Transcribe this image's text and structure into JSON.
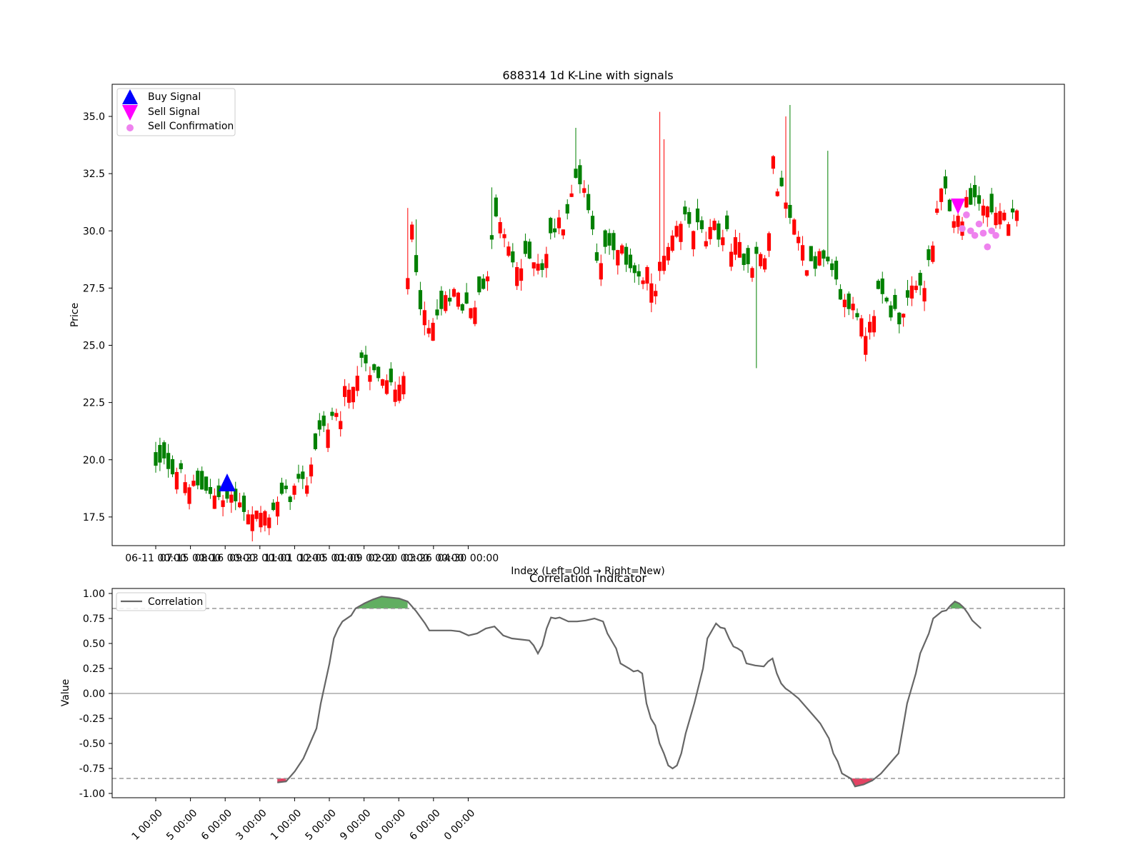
{
  "chart_data": [
    {
      "type": "candlestick",
      "title": "688314 1d K-Line with signals",
      "xlabel": "Index (Left=Old → Right=New)",
      "ylabel": "Price",
      "ylim": [
        16.3,
        36.4
      ],
      "xlim": [
        -10,
        209
      ],
      "yticks": [
        "17.5",
        "20.0",
        "22.5",
        "25.0",
        "27.5",
        "30.0",
        "32.5",
        "35.0"
      ],
      "xticks": [
        {
          "index": 0,
          "label": "06-11 00:00"
        },
        {
          "index": 20,
          "label": "07-15 00:00"
        },
        {
          "index": 40,
          "label": "08-16 00:00"
        },
        {
          "index": 60,
          "label": "09-23 00:00"
        },
        {
          "index": 80,
          "label": "11-01 00:00"
        },
        {
          "index": 100,
          "label": "12-05 00:00"
        },
        {
          "index": 120,
          "label": "01-09 00:00"
        },
        {
          "index": 140,
          "label": "02-20 00:00"
        },
        {
          "index": 160,
          "label": "03-26 00:00"
        },
        {
          "index": 180,
          "label": "04-30 00:00"
        }
      ],
      "close_anchors": [
        [
          0,
          19.6
        ],
        [
          3,
          19.9
        ],
        [
          6,
          19.6
        ],
        [
          9,
          18.9
        ],
        [
          12,
          18.7
        ],
        [
          15,
          18.9
        ],
        [
          17,
          18.4
        ],
        [
          20,
          18.2
        ],
        [
          23,
          18.2
        ],
        [
          26,
          17.9
        ],
        [
          29,
          17.7
        ],
        [
          32,
          17.6
        ],
        [
          35,
          18.1
        ],
        [
          38,
          18.4
        ],
        [
          41,
          18.8
        ],
        [
          43,
          18.7
        ],
        [
          45,
          19.8
        ],
        [
          47,
          21.3
        ],
        [
          50,
          21.5
        ],
        [
          53,
          21.7
        ],
        [
          55,
          23.0
        ],
        [
          58,
          23.8
        ],
        [
          60,
          24.2
        ],
        [
          62,
          23.5
        ],
        [
          64,
          23.8
        ],
        [
          66,
          23.3
        ],
        [
          68,
          23.1
        ],
        [
          70,
          23.6
        ],
        [
          72,
          24.0
        ],
        [
          73,
          28.0
        ],
        [
          74,
          30.4
        ],
        [
          75,
          29.0
        ],
        [
          77,
          26.4
        ],
        [
          79,
          25.6
        ],
        [
          81,
          26.0
        ],
        [
          83,
          26.8
        ],
        [
          85,
          26.7
        ],
        [
          87,
          27.4
        ],
        [
          89,
          26.6
        ],
        [
          91,
          26.4
        ],
        [
          93,
          27.2
        ],
        [
          95,
          27.7
        ],
        [
          97,
          29.2
        ],
        [
          99,
          30.9
        ],
        [
          101,
          29.6
        ],
        [
          103,
          28.6
        ],
        [
          106,
          28.4
        ],
        [
          109,
          29.0
        ],
        [
          112,
          28.5
        ],
        [
          115,
          30.1
        ],
        [
          118,
          30.5
        ],
        [
          120,
          31.2
        ],
        [
          122,
          32.6
        ],
        [
          124,
          31.9
        ],
        [
          126,
          30.2
        ],
        [
          128,
          28.8
        ],
        [
          131,
          29.1
        ],
        [
          134,
          29.0
        ],
        [
          137,
          28.7
        ],
        [
          140,
          27.7
        ],
        [
          142,
          28.0
        ],
        [
          144,
          27.6
        ],
        [
          147,
          28.8
        ],
        [
          150,
          29.6
        ],
        [
          153,
          30.5
        ],
        [
          156,
          30.2
        ],
        [
          159,
          29.6
        ],
        [
          162,
          30.1
        ],
        [
          165,
          29.7
        ],
        [
          168,
          29.3
        ],
        [
          171,
          28.8
        ],
        [
          173,
          28.7
        ],
        [
          175,
          29.0
        ],
        [
          177,
          28.5
        ],
        [
          178,
          33.2
        ],
        [
          180,
          32.0
        ],
        [
          182,
          31.2
        ],
        [
          184,
          30.8
        ],
        [
          186,
          29.8
        ],
        [
          188,
          28.7
        ],
        [
          190,
          28.7
        ],
        [
          192,
          28.8
        ],
        [
          194,
          28.4
        ],
        [
          196,
          27.8
        ],
        [
          198,
          27.2
        ],
        [
          200,
          26.6
        ],
        [
          202,
          27.0
        ],
        [
          204,
          25.8
        ],
        [
          205,
          25.6
        ],
        [
          207,
          26.5
        ],
        [
          209,
          27.1
        ],
        [
          211,
          26.9
        ],
        [
          213,
          26.4
        ],
        [
          215,
          26.3
        ],
        [
          218,
          27.1
        ],
        [
          221,
          27.5
        ],
        [
          223,
          28.0
        ],
        [
          225,
          29.5
        ],
        [
          226,
          31.2
        ],
        [
          228,
          31.6
        ],
        [
          230,
          30.8
        ],
        [
          232,
          30.5
        ],
        [
          234,
          31.0
        ],
        [
          236,
          31.5
        ],
        [
          238,
          31.2
        ],
        [
          240,
          31.0
        ],
        [
          243,
          30.9
        ],
        [
          245,
          30.8
        ],
        [
          247,
          30.3
        ],
        [
          249,
          30.6
        ]
      ],
      "wick_spikes": [
        [
          73,
          31.0
        ],
        [
          75,
          30.5
        ],
        [
          97,
          31.9
        ],
        [
          121,
          34.5
        ],
        [
          146,
          35.2
        ],
        [
          147,
          34.0
        ],
        [
          182,
          35.0
        ],
        [
          183,
          35.5
        ],
        [
          194,
          33.5
        ],
        [
          174,
          24.0
        ]
      ],
      "buy_signals": [
        {
          "index": 17,
          "price": 18.9
        }
      ],
      "sell_signals": [
        {
          "index": 191,
          "price": 31.1
        }
      ],
      "sell_confirmations": [
        {
          "index": 192,
          "price": 30.1
        },
        {
          "index": 193,
          "price": 30.7
        },
        {
          "index": 194,
          "price": 30.0
        },
        {
          "index": 195,
          "price": 29.8
        },
        {
          "index": 196,
          "price": 30.3
        },
        {
          "index": 197,
          "price": 29.9
        },
        {
          "index": 198,
          "price": 29.3
        },
        {
          "index": 199,
          "price": 30.0
        },
        {
          "index": 200,
          "price": 29.8
        }
      ],
      "legend": {
        "position": "top-left",
        "entries": [
          "Buy Signal",
          "Sell Signal",
          "Sell Confirmation"
        ]
      },
      "colors": {
        "up": "#ff0000",
        "down": "#008000",
        "buy": "#0000ff",
        "sell": "#ff00ff",
        "confirm": "#ee82ee"
      }
    },
    {
      "type": "line",
      "title": "Correlation Indicator",
      "ylabel": "Value",
      "ylim": [
        -1.05,
        1.05
      ],
      "yticks": [
        "-1.00",
        "-0.75",
        "-0.50",
        "-0.25",
        "0.00",
        "0.25",
        "0.50",
        "0.75",
        "1.00"
      ],
      "xticks_rotated": [
        "1 00:00",
        "5 00:00",
        "6 00:00",
        "3 00:00",
        "1 00:00",
        "5 00:00",
        "9 00:00",
        "0 00:00",
        "6 00:00",
        "0 00:00"
      ],
      "thresholds": [
        0.85,
        -0.85
      ],
      "zero_line": 0,
      "series": [
        {
          "name": "Correlation",
          "color": "#666666",
          "points": [
            [
              28,
              -0.89
            ],
            [
              30,
              -0.88
            ],
            [
              32,
              -0.78
            ],
            [
              34,
              -0.65
            ],
            [
              35,
              -0.55
            ],
            [
              37,
              -0.35
            ],
            [
              38,
              -0.1
            ],
            [
              39,
              0.1
            ],
            [
              40,
              0.3
            ],
            [
              41,
              0.55
            ],
            [
              42,
              0.65
            ],
            [
              43,
              0.72
            ],
            [
              45,
              0.78
            ],
            [
              46,
              0.85
            ],
            [
              48,
              0.9
            ],
            [
              50,
              0.94
            ],
            [
              52,
              0.97
            ],
            [
              54,
              0.96
            ],
            [
              56,
              0.95
            ],
            [
              58,
              0.92
            ],
            [
              60,
              0.82
            ],
            [
              62,
              0.7
            ],
            [
              63,
              0.63
            ],
            [
              66,
              0.63
            ],
            [
              68,
              0.63
            ],
            [
              70,
              0.62
            ],
            [
              72,
              0.58
            ],
            [
              74,
              0.6
            ],
            [
              76,
              0.65
            ],
            [
              78,
              0.67
            ],
            [
              80,
              0.58
            ],
            [
              82,
              0.55
            ],
            [
              84,
              0.54
            ],
            [
              86,
              0.53
            ],
            [
              87,
              0.48
            ],
            [
              88,
              0.4
            ],
            [
              89,
              0.48
            ],
            [
              90,
              0.65
            ],
            [
              91,
              0.76
            ],
            [
              92,
              0.75
            ],
            [
              93,
              0.76
            ],
            [
              95,
              0.72
            ],
            [
              97,
              0.72
            ],
            [
              99,
              0.73
            ],
            [
              101,
              0.75
            ],
            [
              103,
              0.72
            ],
            [
              104,
              0.6
            ],
            [
              106,
              0.45
            ],
            [
              107,
              0.3
            ],
            [
              109,
              0.25
            ],
            [
              110,
              0.22
            ],
            [
              111,
              0.23
            ],
            [
              112,
              0.2
            ],
            [
              113,
              -0.1
            ],
            [
              114,
              -0.25
            ],
            [
              115,
              -0.32
            ],
            [
              116,
              -0.5
            ],
            [
              117,
              -0.6
            ],
            [
              118,
              -0.72
            ],
            [
              119,
              -0.75
            ],
            [
              120,
              -0.72
            ],
            [
              121,
              -0.6
            ],
            [
              122,
              -0.4
            ],
            [
              124,
              -0.1
            ],
            [
              126,
              0.25
            ],
            [
              127,
              0.55
            ],
            [
              129,
              0.7
            ],
            [
              130,
              0.66
            ],
            [
              131,
              0.65
            ],
            [
              132,
              0.55
            ],
            [
              133,
              0.47
            ],
            [
              134,
              0.45
            ],
            [
              135,
              0.42
            ],
            [
              136,
              0.3
            ],
            [
              138,
              0.28
            ],
            [
              140,
              0.27
            ],
            [
              141,
              0.32
            ],
            [
              142,
              0.35
            ],
            [
              143,
              0.2
            ],
            [
              144,
              0.1
            ],
            [
              145,
              0.05
            ],
            [
              146,
              0.02
            ],
            [
              148,
              -0.05
            ],
            [
              150,
              -0.15
            ],
            [
              152,
              -0.25
            ],
            [
              153,
              -0.3
            ],
            [
              155,
              -0.45
            ],
            [
              156,
              -0.6
            ],
            [
              157,
              -0.68
            ],
            [
              158,
              -0.8
            ],
            [
              160,
              -0.85
            ],
            [
              161,
              -0.93
            ],
            [
              163,
              -0.91
            ],
            [
              165,
              -0.87
            ],
            [
              167,
              -0.8
            ],
            [
              169,
              -0.7
            ],
            [
              171,
              -0.6
            ],
            [
              172,
              -0.35
            ],
            [
              173,
              -0.1
            ],
            [
              175,
              0.2
            ],
            [
              176,
              0.4
            ],
            [
              178,
              0.6
            ],
            [
              179,
              0.75
            ],
            [
              181,
              0.82
            ],
            [
              182,
              0.83
            ],
            [
              183,
              0.88
            ],
            [
              184,
              0.92
            ],
            [
              185,
              0.9
            ],
            [
              186,
              0.86
            ],
            [
              187,
              0.8
            ],
            [
              188,
              0.73
            ],
            [
              190,
              0.65
            ]
          ]
        }
      ],
      "legend": {
        "position": "top-left",
        "entries": [
          "Correlation"
        ]
      },
      "fill_colors": {
        "above": "#3a9a3a",
        "below": "#dc143c"
      }
    }
  ]
}
